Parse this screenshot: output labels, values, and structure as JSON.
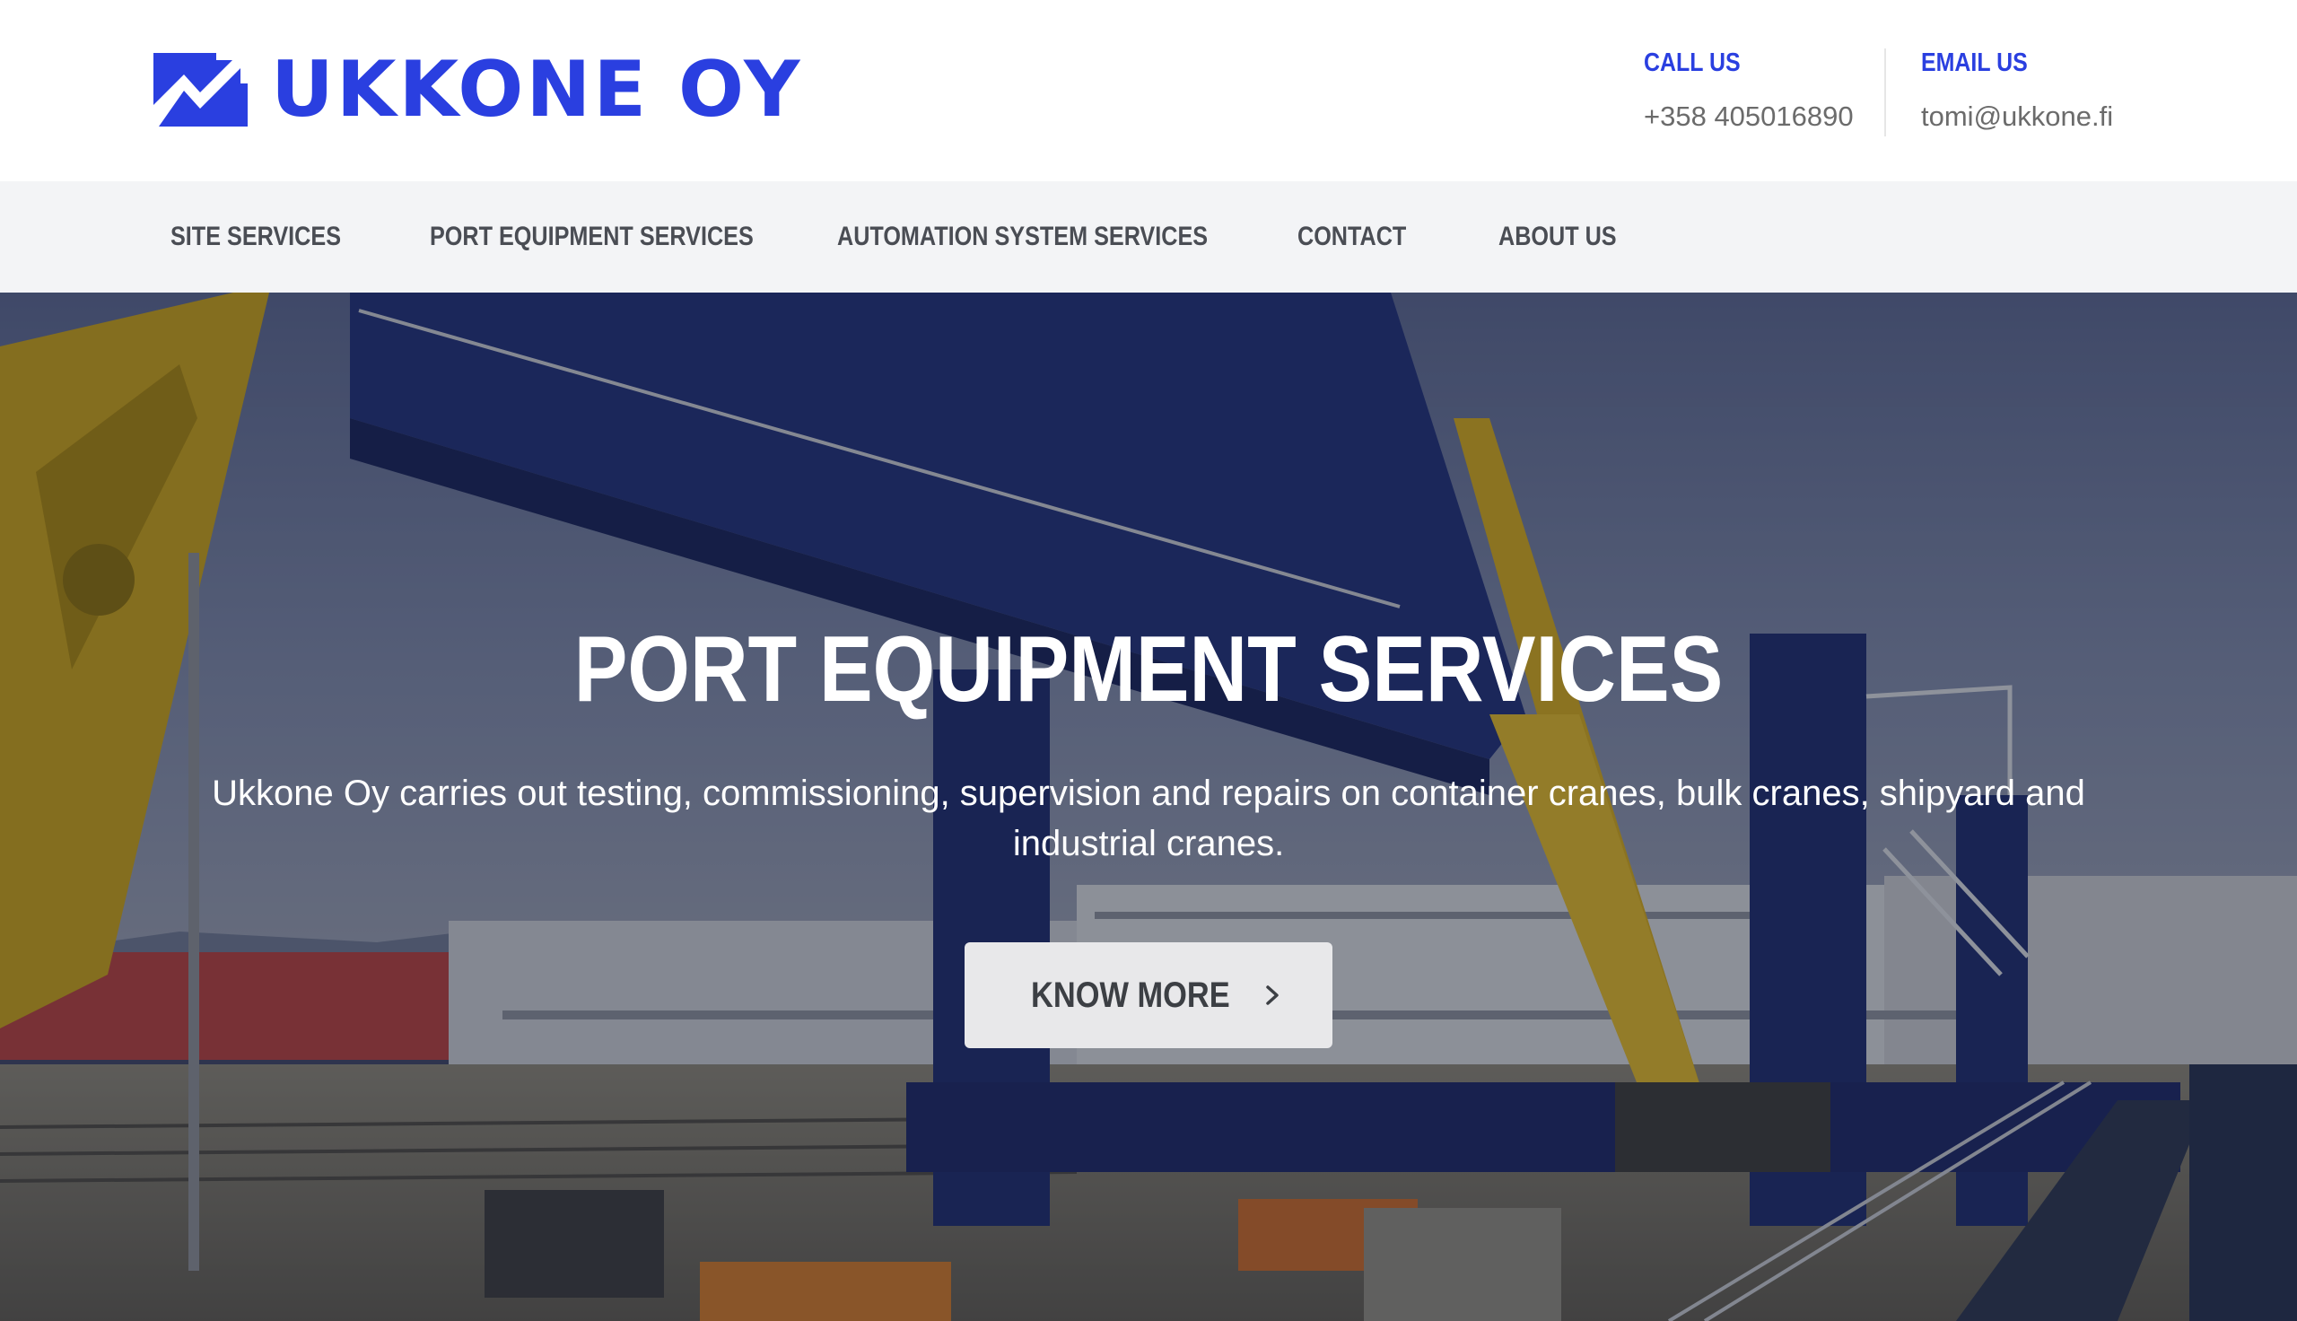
{
  "brand": {
    "name": "UKKONE OY",
    "color": "#2a3fe0"
  },
  "header": {
    "call": {
      "label": "CALL US",
      "value": "+358 405016890"
    },
    "email": {
      "label": "EMAIL US",
      "value": "tomi@ukkone.fi"
    }
  },
  "nav": {
    "items": [
      {
        "label": "SITE SERVICES"
      },
      {
        "label": "PORT EQUIPMENT SERVICES"
      },
      {
        "label": "AUTOMATION SYSTEM SERVICES"
      },
      {
        "label": "CONTACT"
      },
      {
        "label": "ABOUT US"
      }
    ]
  },
  "hero": {
    "title": "PORT EQUIPMENT SERVICES",
    "text": "Ukkone Oy carries out testing, commissioning, supervision and repairs on container cranes, bulk cranes, shipyard and industrial cranes.",
    "button_label": "KNOW MORE",
    "button_icon": "chevron-right-icon",
    "background": "port-crane-photo"
  }
}
